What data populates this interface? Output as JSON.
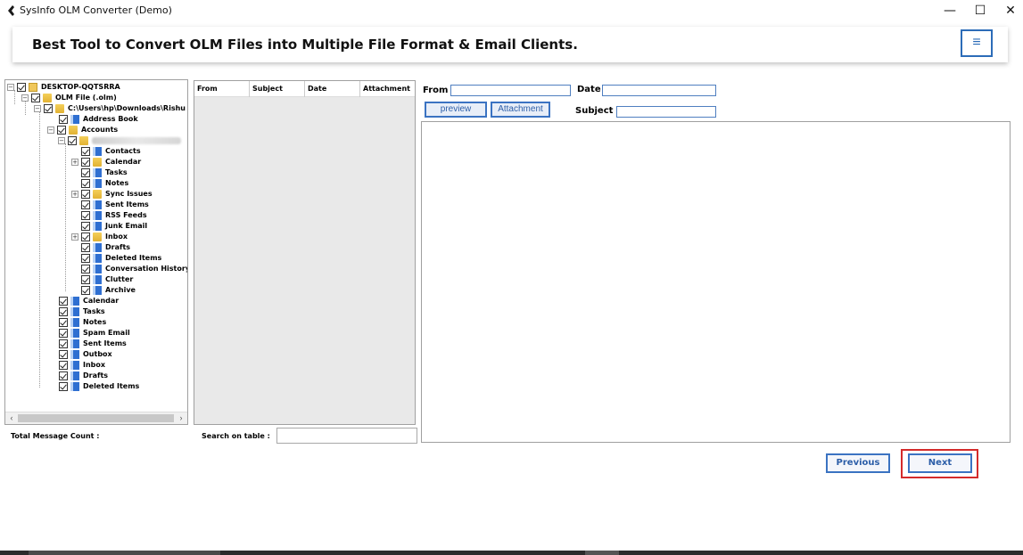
{
  "window": {
    "title": "SysInfo OLM Converter (Demo)",
    "minimize": "—",
    "maximize": "☐",
    "close": "✕"
  },
  "banner": {
    "title": "Best Tool to Convert OLM Files into Multiple File Format & Email Clients.",
    "menu_icon": "≡"
  },
  "tree": {
    "root": "DESKTOP-QQTSRRA",
    "olm_file": "OLM File (.olm)",
    "path": "C:\\Users\\hp\\Downloads\\Rishu Ku",
    "address_book": "Address Book",
    "accounts": "Accounts",
    "account_items": [
      "Contacts",
      "Calendar",
      "Tasks",
      "Notes",
      "Sync Issues",
      "Sent Items",
      "RSS Feeds",
      "Junk Email",
      "Inbox",
      "Drafts",
      "Deleted Items",
      "Conversation History",
      "Clutter",
      "Archive"
    ],
    "top_items": [
      "Calendar",
      "Tasks",
      "Notes",
      "Spam Email",
      "Sent Items",
      "Outbox",
      "Inbox",
      "Drafts",
      "Deleted Items"
    ]
  },
  "grid": {
    "columns": [
      "From",
      "Subject",
      "Date",
      "Attachment"
    ]
  },
  "footer": {
    "total_label": "Total Message Count :",
    "search_label": "Search on table :",
    "search_value": ""
  },
  "details": {
    "from_label": "From",
    "date_label": "Date",
    "subject_label": "Subject",
    "preview_btn": "preview",
    "attachment_btn": "Attachment"
  },
  "nav": {
    "previous": "Previous",
    "next": "Next"
  },
  "colors": {
    "accent": "#3b73c2",
    "highlight": "#d42b2b"
  }
}
